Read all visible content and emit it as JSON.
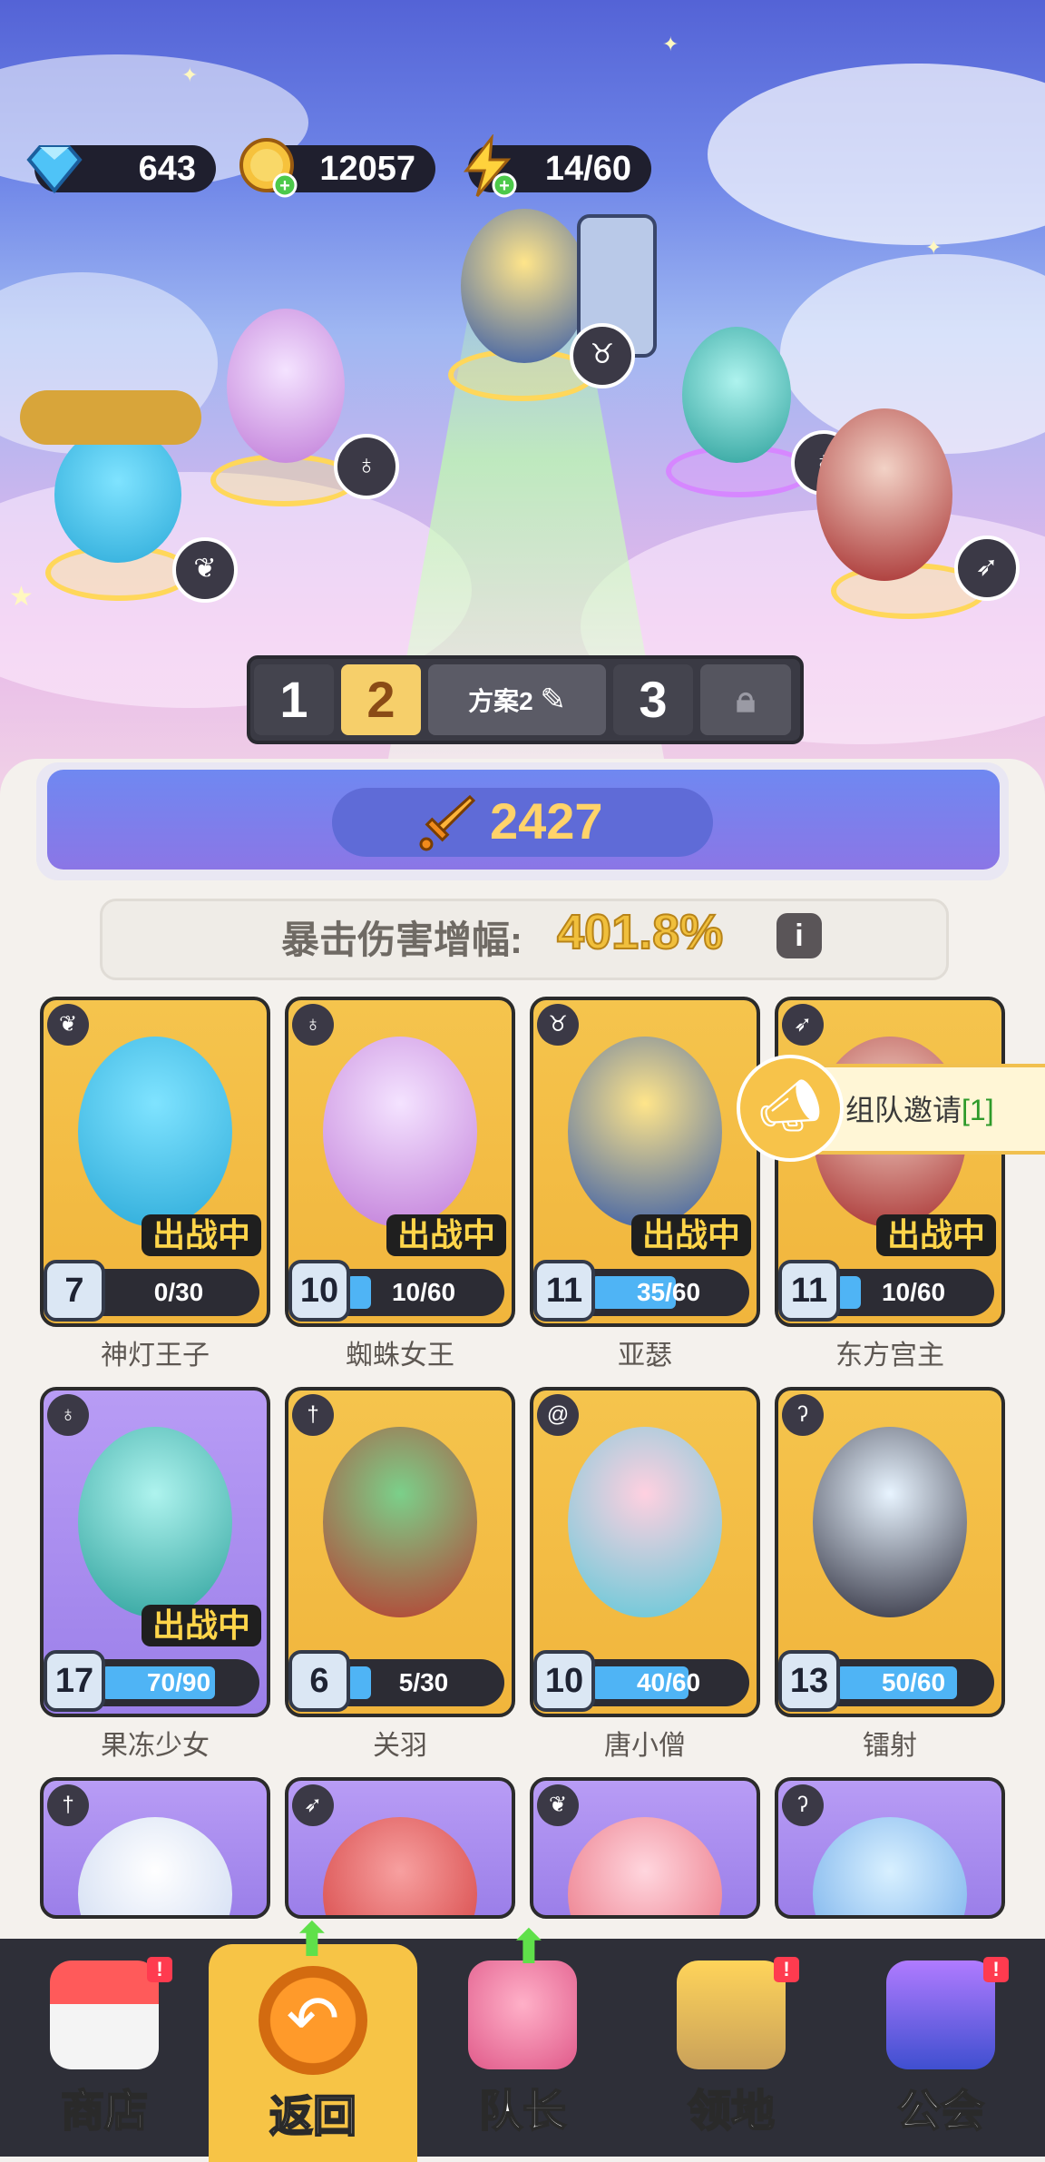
{
  "resources": {
    "gems": "643",
    "coins": "12057",
    "energy": "14/60"
  },
  "plan_tabs": {
    "tab1": "1",
    "tab2": "2",
    "plan_name": "方案2",
    "tab3": "3"
  },
  "power": "2427",
  "crit": {
    "label": "暴击伤害增幅:",
    "value": "401.8%"
  },
  "battle_tag": "出战中",
  "invite": {
    "label": "组队邀请",
    "count": "[1]"
  },
  "cards": [
    {
      "name": "神灯王子",
      "level": "7",
      "progress": "0/30",
      "fill": 0.0,
      "color": "yellow",
      "in_battle": true,
      "type_icon": "wings"
    },
    {
      "name": "蜘蛛女王",
      "level": "10",
      "progress": "10/60",
      "fill": 0.17,
      "color": "yellow",
      "in_battle": true,
      "type_icon": "potion"
    },
    {
      "name": "亚瑟",
      "level": "11",
      "progress": "35/60",
      "fill": 0.58,
      "color": "yellow",
      "in_battle": true,
      "type_icon": "horns"
    },
    {
      "name": "东方宫主",
      "level": "11",
      "progress": "10/60",
      "fill": 0.17,
      "color": "yellow",
      "in_battle": true,
      "type_icon": "bow"
    },
    {
      "name": "果冻少女",
      "level": "17",
      "progress": "70/90",
      "fill": 0.78,
      "color": "purple",
      "in_battle": true,
      "type_icon": "potion"
    },
    {
      "name": "关羽",
      "level": "6",
      "progress": "5/30",
      "fill": 0.17,
      "color": "yellow",
      "in_battle": false,
      "type_icon": "sword"
    },
    {
      "name": "唐小僧",
      "level": "10",
      "progress": "40/60",
      "fill": 0.67,
      "color": "yellow",
      "in_battle": false,
      "type_icon": "swirl"
    },
    {
      "name": "镭射",
      "level": "13",
      "progress": "50/60",
      "fill": 0.83,
      "color": "yellow",
      "in_battle": false,
      "type_icon": "staff"
    },
    {
      "color": "purple",
      "type_icon": "sword"
    },
    {
      "color": "purple",
      "type_icon": "bow"
    },
    {
      "color": "purple",
      "type_icon": "wings"
    },
    {
      "color": "purple",
      "type_icon": "staff"
    }
  ],
  "nav": [
    {
      "label": "商店",
      "icon": "shop-icon",
      "badge": "!",
      "active": false
    },
    {
      "label": "返回",
      "icon": "back-icon",
      "badge": "",
      "active": true,
      "arrow": true
    },
    {
      "label": "队长",
      "icon": "captain-icon",
      "badge": "",
      "active": false,
      "arrow": true
    },
    {
      "label": "领地",
      "icon": "territory-icon",
      "badge": "!",
      "active": false
    },
    {
      "label": "公会",
      "icon": "guild-icon",
      "badge": "!",
      "active": false
    }
  ],
  "colors": {
    "gold": "#f6cf6a",
    "purple_card": "#a98ef0",
    "yellow_card": "#f3bd45",
    "bar_fill": "#4fb4f5",
    "green_text": "#2e9a2a"
  }
}
